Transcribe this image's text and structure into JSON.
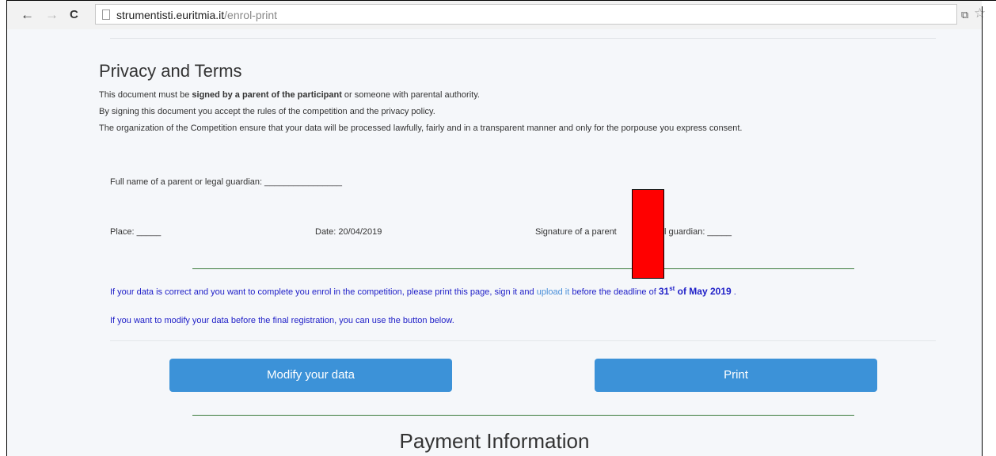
{
  "browser": {
    "back_glyph": "←",
    "forward_glyph": "→",
    "reload_glyph": "C",
    "url_host": "strumentisti.euritmia.it",
    "url_path": "/enrol-print"
  },
  "privacy": {
    "title": "Privacy and Terms",
    "line1_pre": "This document must be ",
    "line1_bold": "signed by a parent of the participant",
    "line1_post": " or someone with parental authority.",
    "line2": "By signing this document you accept the rules of the competition and the privacy policy.",
    "line3": "The organization of the Competition ensure that your data will be processed lawfully, fairly and in a transparent manner and only for the porpouse you express consent."
  },
  "form": {
    "guardian_name": "Full name of a parent or legal guardian: ________________",
    "place": "Place: _____",
    "date": "Date: 20/04/2019",
    "signature_left": "Signature of a parent",
    "signature_right": "l guardian: _____"
  },
  "notice": {
    "text_pre": "If your data is correct and you want to complete you enrol in the competition, please print this page, sign it and ",
    "link": "upload it",
    "text_mid": " before the deadline of ",
    "deadline_day": "31",
    "deadline_sup": "st",
    "deadline_rest": " of May 2019",
    "text_end": " .",
    "modify_hint": "If you want to modify your data before the final registration, you can use the button below."
  },
  "buttons": {
    "modify": "Modify your data",
    "print": "Print"
  },
  "payment": {
    "title": "Payment Information"
  },
  "colors": {
    "button": "#3c92d8",
    "notice_text": "#2020c8",
    "link": "#4a8fd9",
    "divider_green": "#3a7a3a",
    "redaction": "#ff0000"
  }
}
